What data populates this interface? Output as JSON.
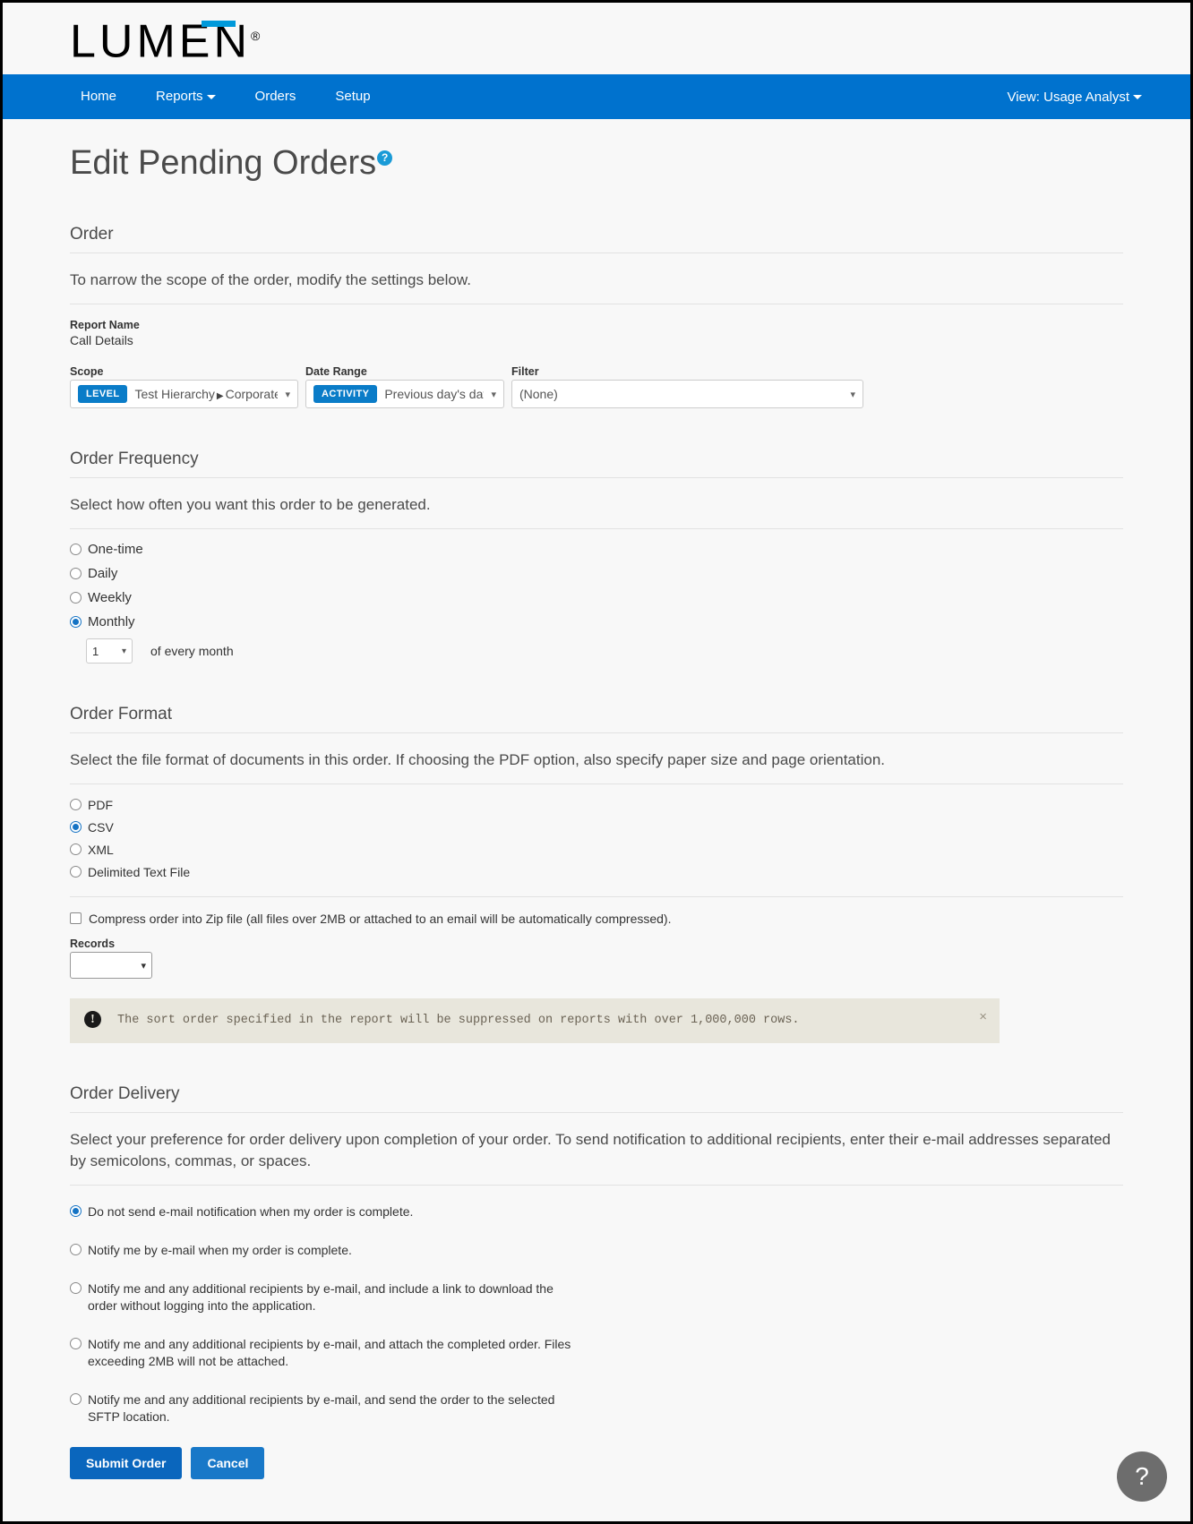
{
  "brand": {
    "logo_text": "LUMEN",
    "registered_mark": "®"
  },
  "nav": {
    "items": [
      {
        "label": "Home",
        "has_caret": false
      },
      {
        "label": "Reports",
        "has_caret": true
      },
      {
        "label": "Orders",
        "has_caret": false
      },
      {
        "label": "Setup",
        "has_caret": false
      }
    ],
    "view_label": "View: Usage Analyst"
  },
  "page": {
    "title": "Edit Pending Orders",
    "help_icon": "question-mark-icon"
  },
  "order": {
    "heading": "Order",
    "description": "To narrow the scope of the order, modify the settings below.",
    "report_name_label": "Report Name",
    "report_name_value": "Call Details",
    "scope": {
      "label": "Scope",
      "badge": "LEVEL",
      "value_root": "Test Hierarchy",
      "separator": "▶",
      "value_leaf": "Corporate"
    },
    "date_range": {
      "label": "Date Range",
      "badge": "ACTIVITY",
      "value": "Previous day's data"
    },
    "filter": {
      "label": "Filter",
      "value": "(None)"
    }
  },
  "frequency": {
    "heading": "Order Frequency",
    "description": "Select how often you want this order to be generated.",
    "options": [
      {
        "label": "One-time",
        "selected": false
      },
      {
        "label": "Daily",
        "selected": false
      },
      {
        "label": "Weekly",
        "selected": false
      },
      {
        "label": "Monthly",
        "selected": true
      }
    ],
    "day_of_month": "1",
    "day_suffix": "of every month"
  },
  "format": {
    "heading": "Order Format",
    "description": "Select the file format of documents in this order. If choosing the PDF option, also specify paper size and page orientation.",
    "options": [
      {
        "label": "PDF",
        "selected": false
      },
      {
        "label": "CSV",
        "selected": true
      },
      {
        "label": "XML",
        "selected": false
      },
      {
        "label": "Delimited Text File",
        "selected": false
      }
    ],
    "compress_label": "Compress order into Zip file (all files over 2MB or attached to an email will be automatically compressed).",
    "compress_checked": false,
    "records_label": "Records",
    "records_value": "",
    "alert": {
      "icon": "exclamation-icon",
      "text": "The sort order specified in the report will be suppressed on reports with over 1,000,000 rows.",
      "close_label": "×"
    }
  },
  "delivery": {
    "heading": "Order Delivery",
    "description": "Select your preference for order delivery upon completion of your order. To send notification to additional recipients, enter their e-mail addresses separated by semicolons, commas, or spaces.",
    "options": [
      {
        "label": "Do not send e-mail notification when my order is complete.",
        "selected": true
      },
      {
        "label": "Notify me by e-mail when my order is complete.",
        "selected": false
      },
      {
        "label": "Notify me and any additional recipients by e-mail, and include a link to download the order without logging into the application.",
        "selected": false
      },
      {
        "label": "Notify me and any additional recipients by e-mail, and attach the completed order. Files exceeding 2MB will not be attached.",
        "selected": false
      },
      {
        "label": "Notify me and any additional recipients by e-mail, and send the order to the selected SFTP location.",
        "selected": false
      }
    ]
  },
  "actions": {
    "submit_label": "Submit Order",
    "cancel_label": "Cancel"
  },
  "fab": {
    "label": "?"
  },
  "colors": {
    "brand_blue": "#0072ce",
    "accent_blue": "#0099da",
    "badge_blue": "#0a7cc8",
    "alert_bg": "#e8e6dc"
  }
}
